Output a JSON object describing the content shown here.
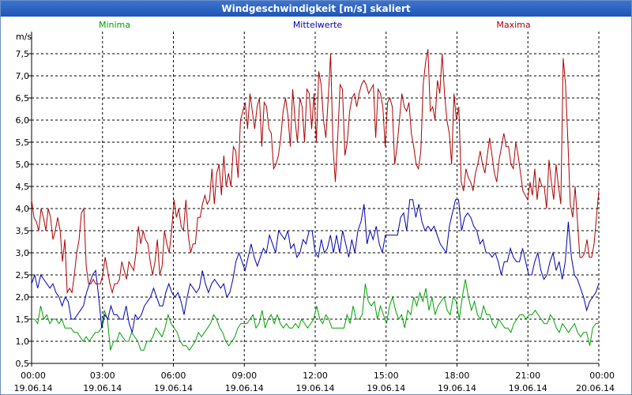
{
  "window": {
    "title": "Windgeschwindigkeit [m/s] skaliert"
  },
  "chart_data": {
    "type": "line",
    "title": "Windgeschwindigkeit [m/s] skaliert",
    "ylabel": "m/s",
    "xlabel": "",
    "ylim": [
      0.5,
      8.0
    ],
    "xlim": [
      0,
      24
    ],
    "grid": true,
    "legend_placement": "top",
    "y_ticks": [
      "0,5",
      "1,0",
      "1,5",
      "2,0",
      "2,5",
      "3,0",
      "3,5",
      "4,0",
      "4,5",
      "5,0",
      "5,5",
      "6,0",
      "6,5",
      "7,0",
      "7,5"
    ],
    "x_ticks": [
      {
        "time": "00:00",
        "date": "19.06.14"
      },
      {
        "time": "03:00",
        "date": "19.06.14"
      },
      {
        "time": "06:00",
        "date": "19.06.14"
      },
      {
        "time": "09:00",
        "date": "19.06.14"
      },
      {
        "time": "12:00",
        "date": "19.06.14"
      },
      {
        "time": "15:00",
        "date": "19.06.14"
      },
      {
        "time": "18:00",
        "date": "19.06.14"
      },
      {
        "time": "21:00",
        "date": "19.06.14"
      },
      {
        "time": "00:00",
        "date": "20.06.14"
      }
    ],
    "series": [
      {
        "name": "Minima",
        "color": "#00a000",
        "values": [
          1.5,
          1.5,
          1.4,
          1.8,
          1.5,
          1.6,
          1.4,
          1.5,
          1.5,
          1.4,
          1.5,
          1.3,
          1.3,
          1.3,
          1.2,
          1.2,
          1.1,
          1.0,
          1.1,
          1.0,
          1.1,
          1.2,
          1.2,
          1.3,
          1.7,
          1.5,
          0.8,
          1.0,
          1.0,
          1.2,
          1.1,
          1.0,
          1.0,
          1.2,
          1.1,
          1.0,
          0.8,
          0.8,
          1.0,
          1.0,
          1.1,
          1.3,
          1.2,
          1.1,
          1.3,
          1.6,
          1.4,
          1.3,
          1.2,
          1.0,
          0.9,
          0.9,
          0.8,
          0.9,
          1.0,
          1.2,
          1.1,
          1.2,
          1.3,
          1.4,
          1.6,
          1.5,
          1.3,
          1.2,
          1.0,
          0.9,
          1.0,
          1.1,
          1.3,
          1.4,
          1.4,
          1.4,
          1.5,
          1.6,
          1.3,
          1.4,
          1.7,
          1.3,
          1.5,
          1.6,
          1.4,
          1.6,
          1.4,
          1.3,
          1.4,
          1.3,
          1.3,
          1.4,
          1.3,
          1.5,
          1.4,
          1.3,
          1.4,
          1.5,
          1.8,
          1.5,
          1.4,
          1.6,
          1.5,
          1.3,
          1.3,
          1.3,
          1.3,
          1.3,
          1.6,
          1.4,
          1.8,
          1.5,
          1.5,
          1.6,
          2.3,
          1.9,
          1.8,
          1.9,
          1.5,
          1.8,
          1.6,
          1.4,
          1.8,
          2.0,
          1.7,
          1.5,
          1.6,
          1.3,
          1.7,
          1.6,
          2.0,
          1.8,
          2.1,
          1.9,
          2.2,
          1.7,
          2.0,
          1.6,
          1.8,
          1.9,
          2.0,
          1.7,
          1.6,
          2.0,
          1.9,
          1.5,
          2.0,
          2.4,
          2.0,
          1.7,
          1.9,
          1.6,
          1.5,
          1.8,
          1.6,
          1.6,
          1.4,
          1.3,
          1.5,
          1.4,
          1.3,
          1.3,
          1.2,
          1.4,
          1.5,
          1.6,
          1.6,
          1.5,
          1.6,
          1.6,
          1.7,
          1.6,
          1.5,
          1.4,
          1.4,
          1.6,
          1.5,
          1.3,
          1.2,
          1.4,
          1.3,
          1.2,
          1.3,
          1.4,
          1.2,
          1.1,
          1.2,
          1.2,
          0.9,
          1.3,
          1.4,
          1.4
        ],
        "label_time_hours": 1.75
      },
      {
        "name": "Mittelwerte",
        "color": "#0000b0",
        "values": [
          2.3,
          2.5,
          2.2,
          2.5,
          2.4,
          2.3,
          2.2,
          2.3,
          2.1,
          2.0,
          1.8,
          2.0,
          1.9,
          1.5,
          1.5,
          1.6,
          1.7,
          1.8,
          2.1,
          2.3,
          2.5,
          2.6,
          2.0,
          1.3,
          1.6,
          1.5,
          1.8,
          1.6,
          1.6,
          1.5,
          1.5,
          1.8,
          1.4,
          1.2,
          1.6,
          1.5,
          1.6,
          1.8,
          1.9,
          2.0,
          2.2,
          2.0,
          1.8,
          1.8,
          2.1,
          2.3,
          2.1,
          2.0,
          2.1,
          1.9,
          1.6,
          2.0,
          2.3,
          2.2,
          2.1,
          2.2,
          2.6,
          2.3,
          2.1,
          2.3,
          2.4,
          2.3,
          2.2,
          2.3,
          2.0,
          2.1,
          2.4,
          2.8,
          3.0,
          2.8,
          2.6,
          2.9,
          3.2,
          2.9,
          2.7,
          2.9,
          3.1,
          3.0,
          3.4,
          3.2,
          3.0,
          3.5,
          3.4,
          3.3,
          3.5,
          3.1,
          3.2,
          2.9,
          3.0,
          3.3,
          3.2,
          3.5,
          3.5,
          3.0,
          2.9,
          3.3,
          3.0,
          3.1,
          3.4,
          3.0,
          3.4,
          3.0,
          3.5,
          3.2,
          2.9,
          3.3,
          3.0,
          3.5,
          3.7,
          4.1,
          3.2,
          3.5,
          3.3,
          3.6,
          3.2,
          3.0,
          3.4,
          3.4,
          3.4,
          3.4,
          3.4,
          3.8,
          3.9,
          3.5,
          4.2,
          4.2,
          3.8,
          4.1,
          3.7,
          3.5,
          3.6,
          3.5,
          3.6,
          3.4,
          3.2,
          3.1,
          3.0,
          3.6,
          3.9,
          4.2,
          4.2,
          3.5,
          3.8,
          3.9,
          3.8,
          3.6,
          3.5,
          3.2,
          3.3,
          3.0,
          3.0,
          2.9,
          3.0,
          2.8,
          2.5,
          2.8,
          2.8,
          3.1,
          2.9,
          2.8,
          2.8,
          3.1,
          2.8,
          2.5,
          2.5,
          2.8,
          3.0,
          2.6,
          2.4,
          2.5,
          2.8,
          3.0,
          2.6,
          2.8,
          2.4,
          2.8,
          3.7,
          2.9,
          2.5,
          2.4,
          2.2,
          2.0,
          1.7,
          1.9,
          2.0,
          2.1,
          2.3
        ]
      },
      {
        "name": "Maxima",
        "color": "#b00000",
        "values": [
          4.2,
          3.8,
          3.7,
          3.5,
          4.0,
          3.8,
          3.5,
          4.0,
          3.8,
          3.3,
          3.5,
          3.8,
          3.5,
          2.8,
          3.3,
          2.1,
          2.2,
          2.1,
          2.5,
          3.0,
          3.3,
          3.9,
          4.0,
          2.7,
          2.3,
          2.3,
          2.4,
          2.3,
          2.3,
          2.3,
          2.5,
          2.9,
          2.6,
          2.3,
          2.1,
          2.3,
          2.3,
          2.4,
          2.8,
          2.6,
          2.4,
          2.8,
          2.7,
          2.6,
          3.0,
          3.6,
          3.2,
          3.5,
          3.3,
          3.2,
          2.8,
          2.5,
          2.8,
          3.3,
          2.5,
          2.7,
          3.5,
          3.2,
          3.0,
          3.5,
          4.2,
          3.8,
          4.0,
          3.6,
          3.5,
          4.2,
          3.4,
          3.0,
          3.2,
          3.2,
          3.8,
          3.8,
          4.1,
          4.3,
          4.1,
          4.2,
          4.9,
          4.1,
          4.8,
          5.0,
          4.3,
          5.2,
          4.5,
          4.8,
          4.5,
          5.4,
          5.3,
          4.7,
          6.0,
          6.2,
          6.4,
          5.8,
          6.6,
          6.2,
          5.8,
          6.3,
          6.5,
          5.4,
          6.4,
          6.3,
          5.8,
          5.7,
          4.9,
          5.0,
          5.2,
          5.6,
          6.2,
          6.5,
          6.1,
          5.4,
          6.7,
          6.0,
          5.5,
          6.5,
          6.3,
          5.5,
          6.7,
          6.6,
          5.8,
          6.6,
          5.5,
          7.1,
          6.8,
          6.0,
          5.6,
          6.5,
          7.5,
          5.4,
          4.6,
          5.6,
          6.8,
          6.7,
          5.2,
          5.5,
          6.2,
          6.5,
          6.6,
          6.3,
          6.6,
          6.8,
          6.9,
          6.8,
          6.6,
          6.7,
          6.8,
          5.6,
          6.7,
          6.6,
          6.3,
          5.4,
          6.4,
          6.5,
          6.3,
          5.0,
          5.4,
          6.0,
          6.6,
          6.3,
          6.2,
          6.4,
          5.7,
          5.4,
          5.0,
          4.9,
          5.3,
          6.8,
          7.3,
          7.6,
          6.2,
          6.3,
          6.0,
          6.9,
          6.6,
          7.5,
          6.6,
          6.0,
          5.7,
          5.0,
          6.6,
          6.0,
          6.3,
          4.6,
          4.4,
          4.9,
          4.7,
          4.6,
          4.4,
          4.8,
          5.0,
          5.3,
          5.0,
          4.8,
          5.2,
          5.6,
          5.2,
          4.8,
          4.6,
          5.1,
          5.4,
          5.7,
          5.4,
          5.4,
          5.0,
          4.9,
          5.5,
          5.2,
          4.8,
          4.4,
          4.3,
          4.2,
          4.6,
          4.3,
          4.9,
          4.2,
          4.7,
          4.5,
          4.5,
          4.0,
          5.1,
          4.6,
          4.2,
          5.0,
          4.5,
          4.1,
          7.4,
          6.8,
          5.5,
          4.1,
          3.8,
          4.5,
          3.7,
          2.9,
          2.9,
          3.0,
          3.3,
          2.9,
          2.9,
          3.2,
          3.8,
          4.4
        ]
      }
    ]
  }
}
